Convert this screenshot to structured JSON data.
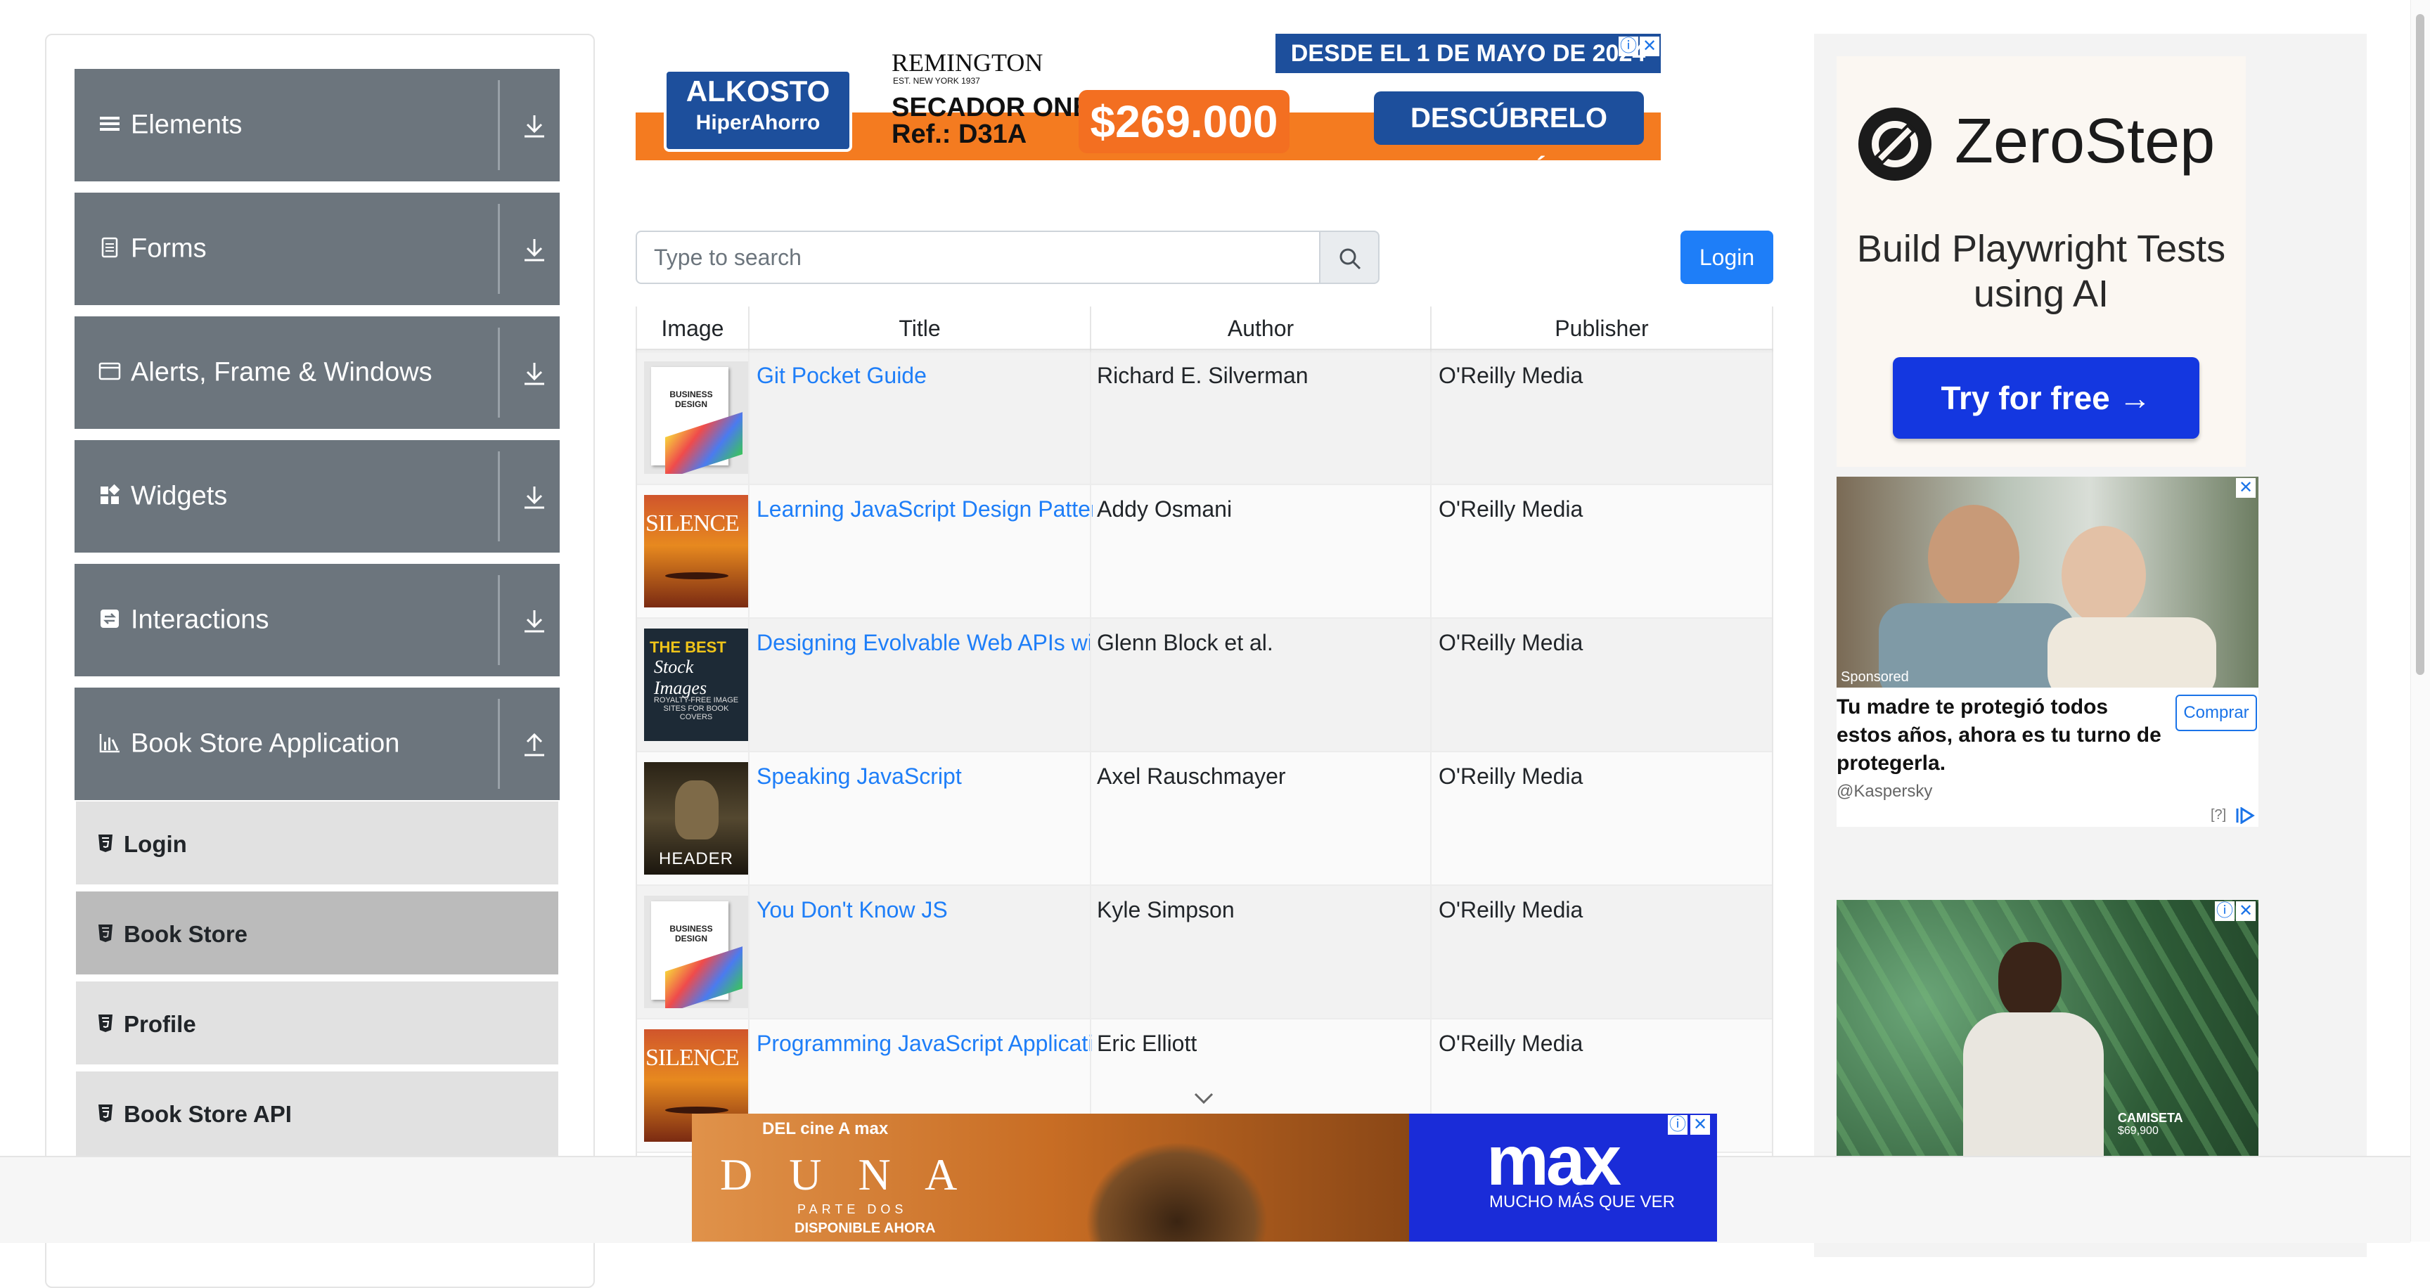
{
  "sidebar": {
    "groups": [
      {
        "label": "Elements",
        "icon": "menu-icon"
      },
      {
        "label": "Forms",
        "icon": "document-icon"
      },
      {
        "label": "Alerts, Frame & Windows",
        "icon": "window-icon"
      },
      {
        "label": "Widgets",
        "icon": "widgets-icon"
      },
      {
        "label": "Interactions",
        "icon": "interactions-icon"
      },
      {
        "label": "Book Store Application",
        "icon": "chart-icon"
      }
    ],
    "bookstore_items": [
      {
        "label": "Login",
        "active": false
      },
      {
        "label": "Book Store",
        "active": true
      },
      {
        "label": "Profile",
        "active": false
      },
      {
        "label": "Book Store API",
        "active": false
      }
    ]
  },
  "search": {
    "placeholder": "Type to search",
    "value": ""
  },
  "login_label": "Login",
  "table": {
    "headers": [
      "Image",
      "Title",
      "Author",
      "Publisher"
    ],
    "rows": [
      {
        "title": "Git Pocket Guide",
        "author": "Richard E. Silverman",
        "publisher": "O'Reilly Media",
        "cover": "business-design"
      },
      {
        "title": "Learning JavaScript Design Patterns",
        "author": "Addy Osmani",
        "publisher": "O'Reilly Media",
        "cover": "silence"
      },
      {
        "title": "Designing Evolvable Web APIs with ASP.NET",
        "author": "Glenn Block et al.",
        "publisher": "O'Reilly Media",
        "cover": "the-best"
      },
      {
        "title": "Speaking JavaScript",
        "author": "Axel Rauschmayer",
        "publisher": "O'Reilly Media",
        "cover": "header"
      },
      {
        "title": "You Don't Know JS",
        "author": "Kyle Simpson",
        "publisher": "O'Reilly Media",
        "cover": "business-design"
      },
      {
        "title": "Programming JavaScript Applications",
        "author": "Eric Elliott",
        "publisher": "O'Reilly Media",
        "cover": "silence"
      }
    ]
  },
  "cover_text": {
    "business_design": "BUSINESS DESIGN",
    "silence": "SILENCE",
    "the_best": "THE BEST",
    "the_best_sub": "Stock Images",
    "the_best_small": "ROYALTY-FREE IMAGE SITES FOR BOOK COVERS",
    "header": "HEADER"
  },
  "ads": {
    "top": {
      "brand": "ALKOSTO",
      "brand_sub": "HiperAhorro",
      "remington": "REMINGTON",
      "remington_sub": "EST. NEW YORK 1937",
      "product": "SECADOR ONE",
      "product_ref": "Ref.: D31A",
      "price": "$269.000",
      "date_banner": "DESDE EL 1 DE MAYO DE 2024",
      "cta": "DESCÚBRELO AQUÍ"
    },
    "zerostep": {
      "brand": "ZeroStep",
      "tagline": "Build Playwright Tests using AI",
      "cta": "Try for free →"
    },
    "kaspersky": {
      "sponsored": "Sponsored",
      "text": "Tu madre te protegió todos estos años, ahora es tu turno de protegerla.",
      "handle": "@Kaspersky",
      "button": "Comprar",
      "help": "[?]"
    },
    "fashion": {
      "caption": "CAMISETA",
      "price": "$69,900"
    },
    "max": {
      "top_line": "DEL cine A max",
      "movie": "D U N A",
      "movie_sub": "PARTE DOS",
      "availability": "DISPONIBLE AHORA",
      "brand": "max",
      "brand_sub": "MUCHO MÁS QUE VER"
    }
  },
  "colors": {
    "sidebar_group": "#6c757d",
    "accent": "#1e7ef8",
    "active_item": "#bbbbbb"
  }
}
